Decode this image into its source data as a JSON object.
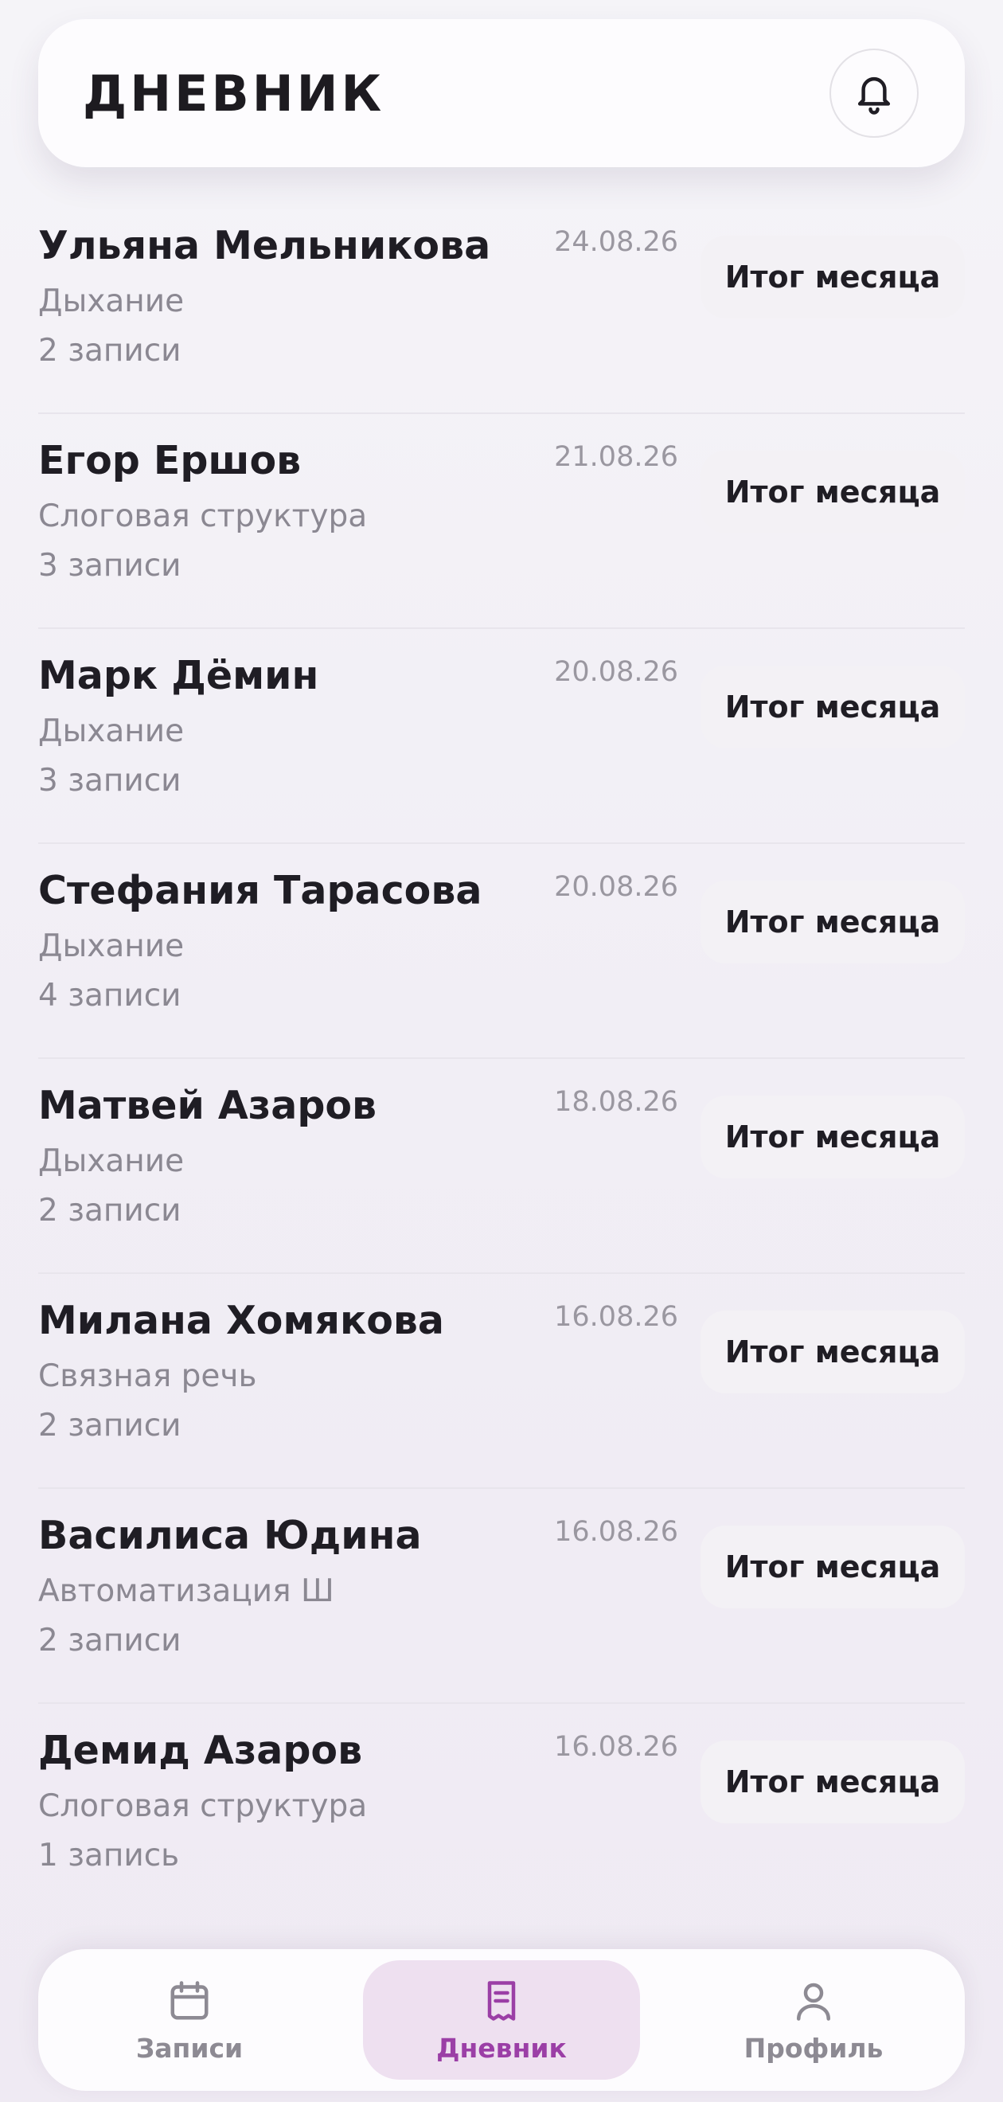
{
  "header": {
    "title": "ДНЕВНИК",
    "bell_icon": "bell-icon"
  },
  "entries": [
    {
      "name": "Ульяна Мельникова",
      "date": "24.08.26",
      "topic": "Дыхание",
      "count": "2 записи",
      "button": "Итог месяца"
    },
    {
      "name": "Егор Ершов",
      "date": "21.08.26",
      "topic": "Слоговая структура",
      "count": "3 записи",
      "button": "Итог месяца"
    },
    {
      "name": "Марк Дёмин",
      "date": "20.08.26",
      "topic": "Дыхание",
      "count": "3 записи",
      "button": "Итог месяца"
    },
    {
      "name": "Стефания Тарасова",
      "date": "20.08.26",
      "topic": "Дыхание",
      "count": "4 записи",
      "button": "Итог месяца"
    },
    {
      "name": "Матвей Азаров",
      "date": "18.08.26",
      "topic": "Дыхание",
      "count": "2 записи",
      "button": "Итог месяца"
    },
    {
      "name": "Милана Хомякова",
      "date": "16.08.26",
      "topic": "Связная речь",
      "count": "2 записи",
      "button": "Итог месяца"
    },
    {
      "name": "Василиса Юдина",
      "date": "16.08.26",
      "topic": "Автоматизация Ш",
      "count": "2 записи",
      "button": "Итог месяца"
    },
    {
      "name": "Демид Азаров",
      "date": "16.08.26",
      "topic": "Слоговая структура",
      "count": "1 запись",
      "button": "Итог месяца"
    }
  ],
  "tabs": [
    {
      "label": "Записи",
      "icon": "calendar-icon",
      "active": false
    },
    {
      "label": "Дневник",
      "icon": "journal-icon",
      "active": true
    },
    {
      "label": "Профиль",
      "icon": "user-icon",
      "active": false
    }
  ],
  "colors": {
    "accent": "#9b3fa6",
    "active_tab_bg": "#eee0f0",
    "muted_text": "#8b8892"
  }
}
